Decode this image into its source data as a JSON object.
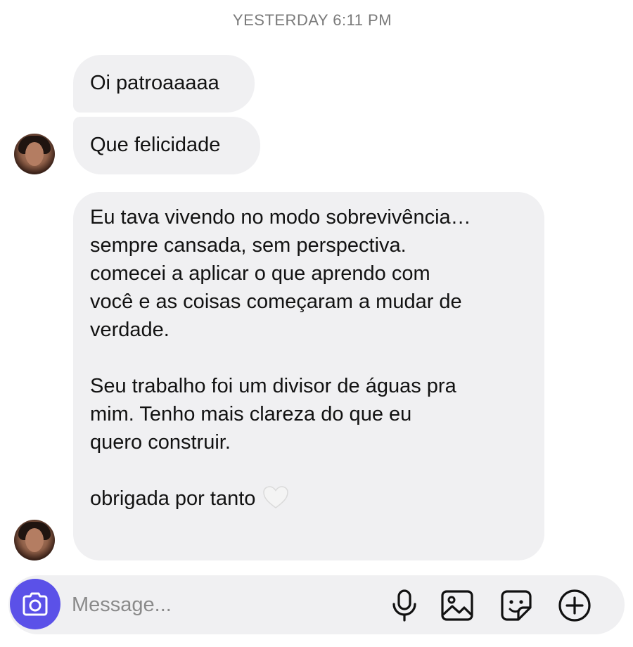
{
  "thread": {
    "timestamp": "YESTERDAY 6:11 PM"
  },
  "messages": [
    {
      "text": "Oi patroaaaaa"
    },
    {
      "text": "Que felicidade"
    },
    {
      "paragraphs": [
        [
          "Eu tava vivendo no modo sobrevivência…",
          "sempre cansada, sem perspectiva.",
          "comecei a aplicar o que aprendo com",
          "você e as coisas começaram a mudar de",
          "verdade."
        ],
        [
          "Seu trabalho foi um divisor de águas pra",
          "mim. Tenho mais clareza do que eu",
          "quero construir."
        ],
        [
          "obrigada por tanto"
        ]
      ],
      "reaction_icon": "white-heart"
    }
  ],
  "composer": {
    "placeholder": "Message...",
    "icons": [
      "camera-icon",
      "microphone-icon",
      "gallery-icon",
      "sticker-icon",
      "plus-icon"
    ],
    "accent_color": "#5b51e8"
  }
}
